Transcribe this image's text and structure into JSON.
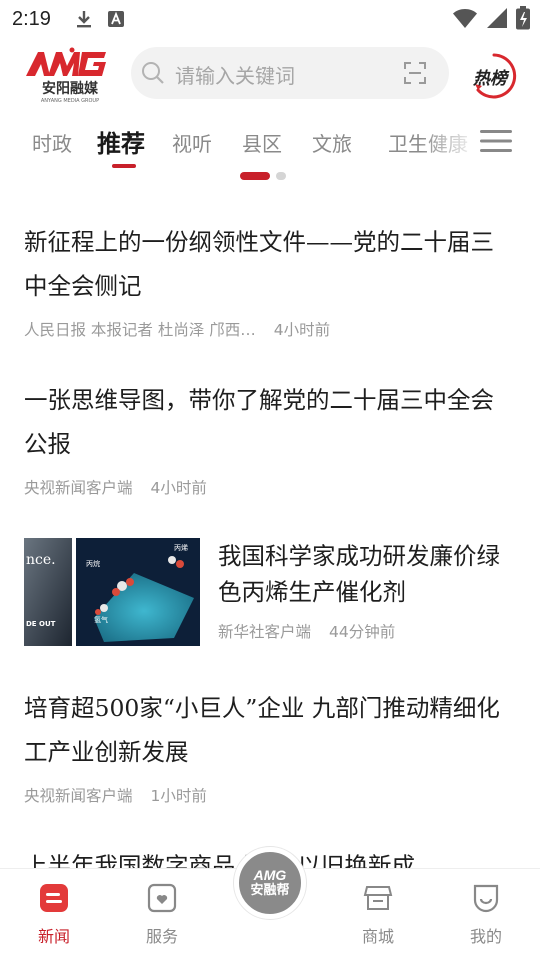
{
  "status_bar": {
    "time": "2:19"
  },
  "header": {
    "logo_text": "AMG",
    "logo_subtitle": "安阳融媒",
    "logo_tagline": "ANYANG MEDIA GROUP",
    "search_placeholder": "请输入关键词",
    "hot_label": "热榜"
  },
  "tabs": [
    {
      "label": "时政",
      "active": false
    },
    {
      "label": "推荐",
      "active": true
    },
    {
      "label": "视听",
      "active": false
    },
    {
      "label": "县区",
      "active": false
    },
    {
      "label": "文旅",
      "active": false
    },
    {
      "label": "卫生健康",
      "active": false
    }
  ],
  "news": [
    {
      "title": "新征程上的一份纲领性文件——党的二十届三中全会侧记",
      "source": "人民日报 本报记者 杜尚泽 邝西…",
      "time": "4小时前"
    },
    {
      "title": "一张思维导图，带你了解党的二十届三中全会公报",
      "source": "央视新闻客户端",
      "time": "4小时前"
    },
    {
      "title": "我国科学家成功研发廉价绿色丙烯生产催化剂",
      "source": "新华社客户端",
      "time": "44分钟前",
      "thumb_text_left": "nce.",
      "thumb_text_left2": "DE OUT",
      "thumb_label_1": "丙烷",
      "thumb_label_2": "丙烯",
      "thumb_label_3": "氢气"
    },
    {
      "title": "培育超500家“小巨人”企业 九部门推动精细化工产业创新发展",
      "source": "央视新闻客户端",
      "time": "1小时前"
    },
    {
      "title": "上半年我国数字商品 消费 以旧换新成",
      "source": "",
      "time": ""
    }
  ],
  "bottom_nav": {
    "news": "新闻",
    "service": "服务",
    "center_top": "AMG",
    "center_bottom": "安融帮",
    "mall": "商城",
    "mine": "我的"
  },
  "colors": {
    "accent": "#c8202a",
    "muted": "#9a9a9a"
  }
}
